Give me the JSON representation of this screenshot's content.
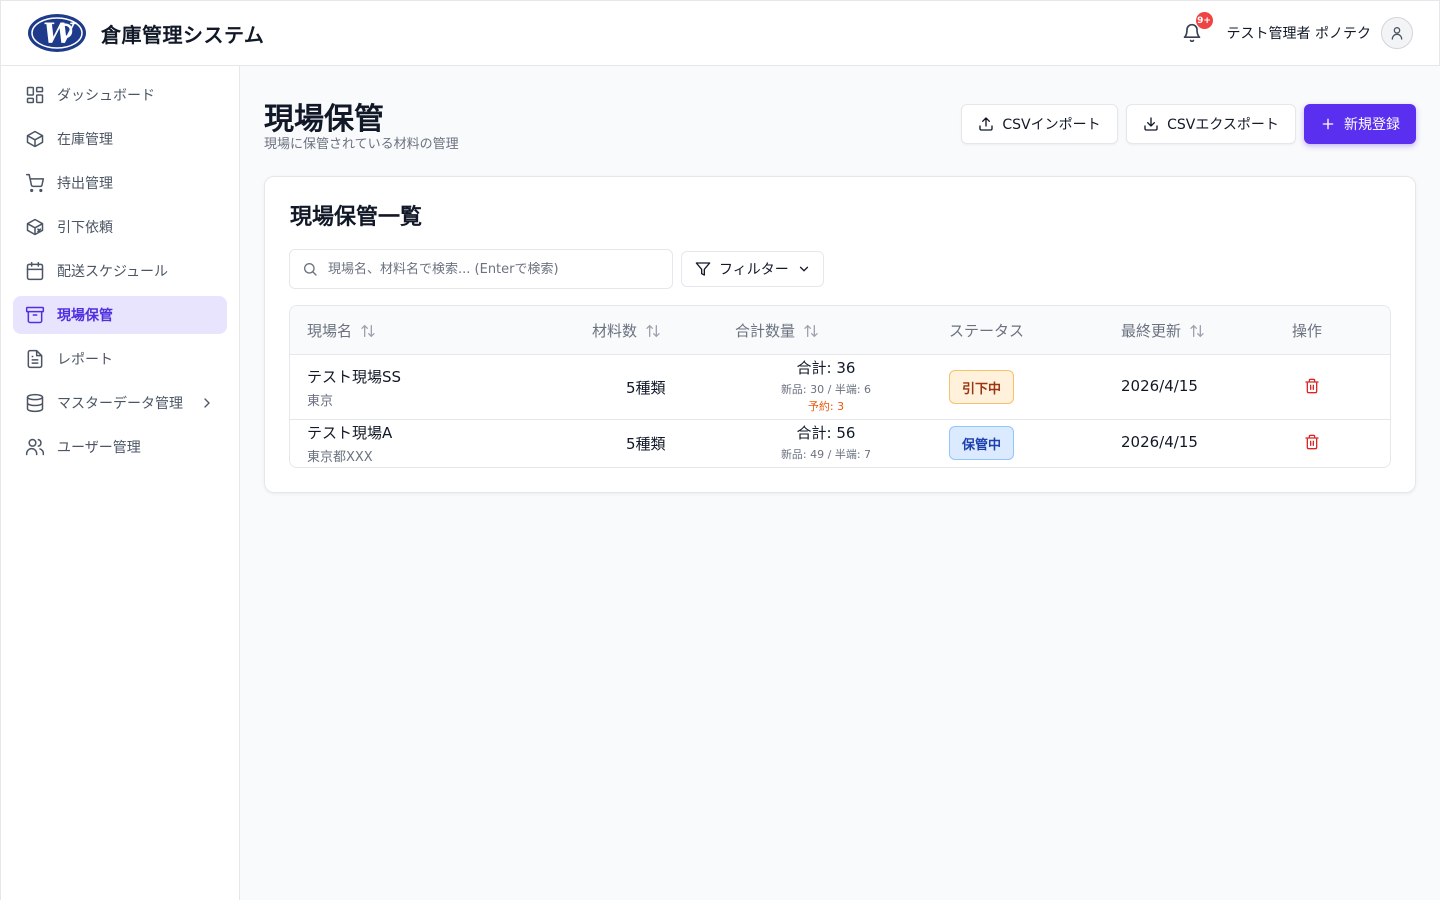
{
  "app": {
    "title": "倉庫管理システム",
    "logo_letters": "W"
  },
  "header": {
    "notification_badge": "9+",
    "user_name": "テスト管理者 ポノテク"
  },
  "sidebar": {
    "items": [
      {
        "label": "ダッシュボード",
        "icon": "dashboard-icon"
      },
      {
        "label": "在庫管理",
        "icon": "box-icon"
      },
      {
        "label": "持出管理",
        "icon": "cart-icon"
      },
      {
        "label": "引下依頼",
        "icon": "package-return-icon"
      },
      {
        "label": "配送スケジュール",
        "icon": "calendar-icon"
      },
      {
        "label": "現場保管",
        "icon": "archive-icon",
        "active": true
      },
      {
        "label": "レポート",
        "icon": "document-icon"
      },
      {
        "label": "マスターデータ管理",
        "icon": "database-icon"
      },
      {
        "label": "ユーザー管理",
        "icon": "users-icon"
      }
    ]
  },
  "page": {
    "title": "現場保管",
    "subtitle": "現場に保管されている材料の管理"
  },
  "actions": {
    "import_label": "CSVインポート",
    "export_label": "CSVエクスポート",
    "new_label": "新規登録"
  },
  "card": {
    "title": "現場保管一覧"
  },
  "search": {
    "placeholder": "現場名、材料名で検索... (Enterで検索)"
  },
  "filter": {
    "label": "フィルター"
  },
  "table": {
    "headers": {
      "site": "現場名",
      "materials": "材料数",
      "quantity": "合計数量",
      "status": "ステータス",
      "updated": "最終更新",
      "actions": "操作"
    },
    "rows": [
      {
        "site_name": "テスト現場SS",
        "location": "東京",
        "materials": "5種類",
        "total": "合計: 36",
        "detail": "新品: 30 / 半端: 6",
        "reserved": "予約: 3",
        "status": "引下中",
        "updated": "2026/4/15"
      },
      {
        "site_name": "テスト現場A",
        "location": "東京都XXX",
        "materials": "5種類",
        "total": "合計: 56",
        "detail": "新品: 49 / 半端: 7",
        "status": "保管中",
        "updated": "2026/4/15"
      }
    ]
  },
  "colors": {
    "accent": "#5b2ff0",
    "active_bg": "#e8e4fd",
    "danger": "#dc2626",
    "warning": "#ea580c"
  }
}
